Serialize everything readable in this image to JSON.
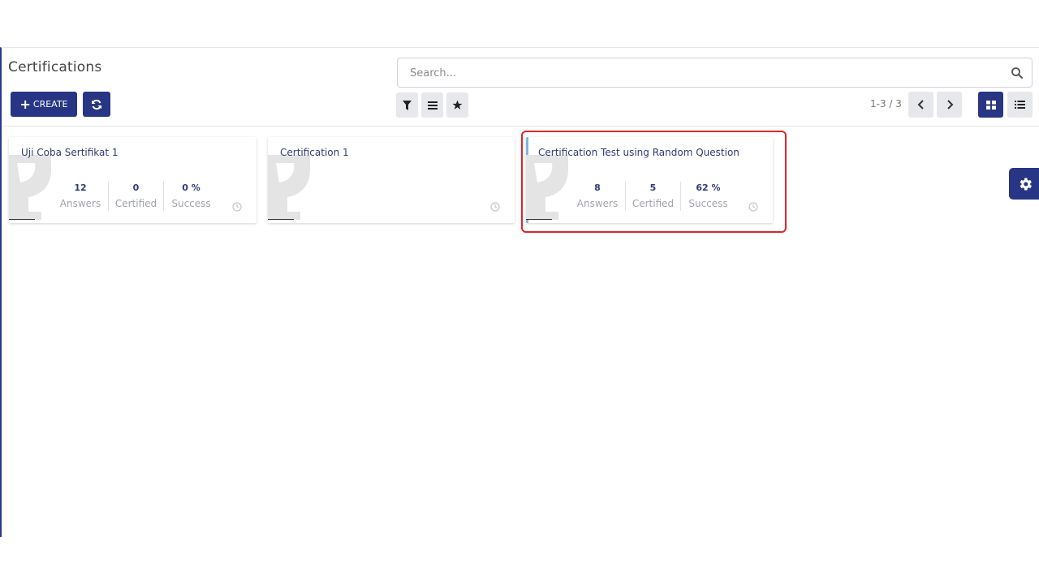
{
  "page": {
    "title": "Certifications"
  },
  "search": {
    "placeholder": "Search..."
  },
  "toolbar": {
    "create_label": "CREATE",
    "pager": "1-3 / 3"
  },
  "colors": {
    "primary": "#283584",
    "title_text": "#2f3b76",
    "highlight": "#e0242c",
    "accent": "#7ab9e0"
  },
  "icons": {
    "create": "plus-icon",
    "refresh": "refresh-icon",
    "filter": "filter-icon",
    "group": "list-icon",
    "favorite": "star-icon",
    "prev": "chevron-left-icon",
    "next": "chevron-right-icon",
    "kanban": "grid-icon",
    "list": "list-view-icon",
    "settings": "gear-icon",
    "search": "search-icon"
  },
  "cards": [
    {
      "title": "Uji Coba Sertifikat 1",
      "stats": [
        {
          "value": "12",
          "label": "Answers"
        },
        {
          "value": "0",
          "label": "Certified"
        },
        {
          "value": "0 %",
          "label": "Success"
        }
      ]
    },
    {
      "title": "Certification 1",
      "stats": []
    },
    {
      "title": "Certification Test using Random Question",
      "stats": [
        {
          "value": "8",
          "label": "Answers"
        },
        {
          "value": "5",
          "label": "Certified"
        },
        {
          "value": "62 %",
          "label": "Success"
        }
      ]
    }
  ]
}
